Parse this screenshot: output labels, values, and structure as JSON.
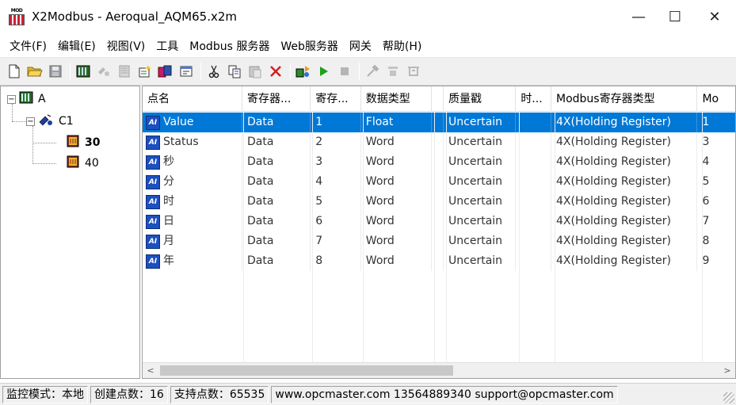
{
  "window": {
    "title": "X2Modbus - Aeroqual_AQM65.x2m",
    "icon_label": "MOD",
    "minimize_glyph": "—",
    "maximize_glyph": "☐",
    "close_glyph": "✕"
  },
  "menu": [
    "文件(F)",
    "编辑(E)",
    "视图(V)",
    "工具",
    "Modbus 服务器",
    "Web服务器",
    "网关",
    "帮助(H)"
  ],
  "toolbar": {
    "icons": [
      "new-file-icon",
      "open-folder-icon",
      "save-icon",
      "sep",
      "channel-icon",
      "device-icon",
      "group-icon",
      "new-item-icon",
      "tags-icon",
      "properties-icon",
      "sep",
      "cut-icon",
      "copy-icon",
      "paste-icon",
      "delete-icon",
      "sep",
      "monitor-icon",
      "run-icon",
      "stop-icon",
      "sep",
      "tools-icon",
      "tool2-icon",
      "tool3-icon"
    ],
    "accent_green": "#1aa01a",
    "accent_red": "#d81e1e"
  },
  "tree": {
    "root": {
      "label": "A",
      "expander": "−"
    },
    "channel": {
      "label": "C1",
      "expander": "−"
    },
    "groups": [
      {
        "label": "30",
        "bold": true
      },
      {
        "label": "40",
        "bold": false
      }
    ]
  },
  "table": {
    "columns": [
      "点名",
      "寄存器...",
      "寄存...",
      "数据类型",
      "",
      "质量戳",
      "时...",
      "Modbus寄存器类型",
      "Mo"
    ],
    "rows": [
      [
        "Value",
        "Data",
        "1",
        "Float",
        "",
        "Uncertain",
        "",
        "4X(Holding Register)",
        "1"
      ],
      [
        "Status",
        "Data",
        "2",
        "Word",
        "",
        "Uncertain",
        "",
        "4X(Holding Register)",
        "3"
      ],
      [
        "秒",
        "Data",
        "3",
        "Word",
        "",
        "Uncertain",
        "",
        "4X(Holding Register)",
        "4"
      ],
      [
        "分",
        "Data",
        "4",
        "Word",
        "",
        "Uncertain",
        "",
        "4X(Holding Register)",
        "5"
      ],
      [
        "时",
        "Data",
        "5",
        "Word",
        "",
        "Uncertain",
        "",
        "4X(Holding Register)",
        "6"
      ],
      [
        "日",
        "Data",
        "6",
        "Word",
        "",
        "Uncertain",
        "",
        "4X(Holding Register)",
        "7"
      ],
      [
        "月",
        "Data",
        "7",
        "Word",
        "",
        "Uncertain",
        "",
        "4X(Holding Register)",
        "8"
      ],
      [
        "年",
        "Data",
        "8",
        "Word",
        "",
        "Uncertain",
        "",
        "4X(Holding Register)",
        "9"
      ]
    ],
    "selected_row": 0,
    "row_icon_label": "AI",
    "selection_color": "#0078d7"
  },
  "scrollbar": {
    "left_arrow": "<",
    "right_arrow": ">"
  },
  "status": {
    "mode": "监控模式：本地",
    "created": "创建点数：16",
    "supported": "支持点数：65535",
    "contact": "www.opcmaster.com 13564889340 support@opcmaster.com"
  }
}
